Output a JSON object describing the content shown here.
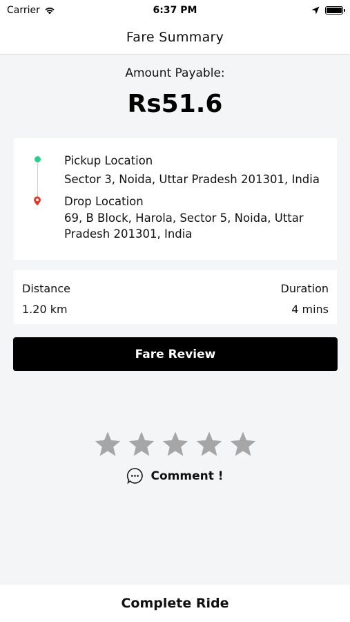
{
  "status_bar": {
    "carrier": "Carrier",
    "time": "6:37 PM",
    "wifi_icon": "wifi-icon",
    "location_icon": "location-arrow-icon",
    "battery_icon": "battery-icon"
  },
  "nav": {
    "title": "Fare Summary"
  },
  "fare": {
    "amount_label": "Amount Payable:",
    "amount_value": "Rs51.6"
  },
  "route": {
    "pickup_title": "Pickup Location",
    "pickup_address": "Sector 3, Noida, Uttar Pradesh 201301, India",
    "drop_title": "Drop Location",
    "drop_address": "69, B Block, Harola, Sector 5, Noida, Uttar Pradesh 201301, India",
    "pickup_color": "#2ecc8f",
    "drop_color": "#e0392b"
  },
  "stats": {
    "distance_label": "Distance",
    "distance_value": "1.20 km",
    "duration_label": "Duration",
    "duration_value": "4 mins"
  },
  "actions": {
    "fare_review_label": "Fare Review",
    "comment_label": "Comment !",
    "complete_ride_label": "Complete Ride"
  },
  "rating": {
    "max_stars": 5,
    "selected": 0,
    "star_color": "#a6a6a6"
  }
}
